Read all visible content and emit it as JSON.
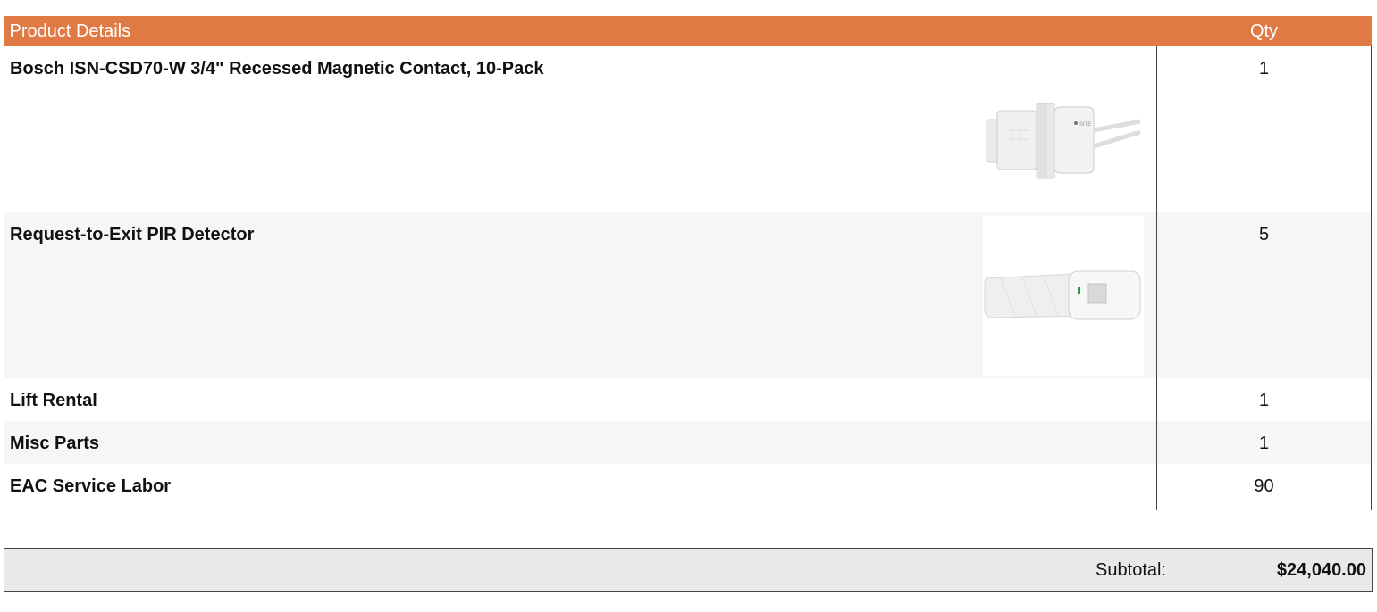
{
  "table": {
    "header": {
      "product": "Product Details",
      "qty": "Qty"
    },
    "rows": [
      {
        "name": "Bosch ISN-CSD70-W 3/4\" Recessed Magnetic Contact, 10-Pack",
        "qty": "1",
        "image": "recessed-contact-image"
      },
      {
        "name": "Request-to-Exit PIR Detector",
        "qty": "5",
        "image": "pir-detector-image"
      },
      {
        "name": "Lift Rental",
        "qty": "1"
      },
      {
        "name": "Misc Parts",
        "qty": "1"
      },
      {
        "name": "EAC Service Labor",
        "qty": "90"
      }
    ]
  },
  "summary": {
    "subtotal_label": "Subtotal:",
    "subtotal_value": "$24,040.00"
  },
  "colors": {
    "header_bg": "#E07A45",
    "header_text": "#FFFFFF",
    "alt_row_bg": "#F6F6F6",
    "subtotal_bg": "#E9E9E9"
  }
}
